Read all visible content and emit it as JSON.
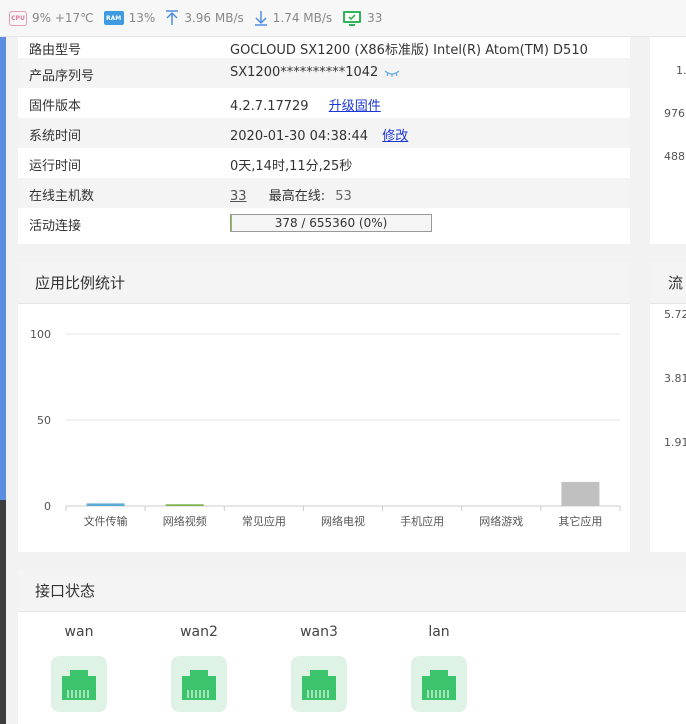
{
  "statusbar": {
    "cpu_icon_label": "CPU",
    "cpu_text": "9% +17℃",
    "ram_icon_label": "RAM",
    "ram_text": "13%",
    "upload_text": "3.96 MB/s",
    "download_text": "1.74 MB/s",
    "hosts_text": "33"
  },
  "info": {
    "rows": [
      {
        "key": "路由型号",
        "value": "GOCLOUD SX1200 (X86标准版) Intel(R) Atom(TM) D510"
      },
      {
        "key": "产品序列号",
        "value": "SX1200**********1042"
      },
      {
        "key": "固件版本",
        "value": "4.2.7.17729",
        "link": "升级固件"
      },
      {
        "key": "系统时间",
        "value": "2020-01-30 04:38:44",
        "link": "修改"
      },
      {
        "key": "运行时间",
        "value": "0天,14时,11分,25秒"
      },
      {
        "key": "在线主机数",
        "value": "33",
        "label2": "最高在线:",
        "value2": "53"
      },
      {
        "key": "活动连接",
        "value": "378 / 655360 (0%)",
        "fraction": 0.0006
      }
    ]
  },
  "app_chart": {
    "title": "应用比例统计"
  },
  "chart_data": {
    "type": "bar",
    "categories": [
      "文件传输",
      "网络视频",
      "常见应用",
      "网络电视",
      "手机应用",
      "网络游戏",
      "其它应用"
    ],
    "values": [
      1.5,
      1.0,
      0,
      0,
      0,
      0,
      14
    ],
    "colors": [
      "#5aa9d6",
      "#7fb34d",
      "#cccccc",
      "#cccccc",
      "#cccccc",
      "#cccccc",
      "#c0c0c0"
    ],
    "yticks": [
      0,
      50,
      100
    ],
    "ylim": [
      0,
      100
    ],
    "grid": true
  },
  "interfaces": {
    "title": "接口状态",
    "items": [
      {
        "name": "wan"
      },
      {
        "name": "wan2"
      },
      {
        "name": "wan3"
      },
      {
        "name": "lan"
      }
    ],
    "port_color": "#3cc46c"
  },
  "right_partial": {
    "top_numbers": [
      "1.",
      "976",
      "488"
    ],
    "chart_title": "流",
    "chart_numbers": [
      "5.72",
      "3.81",
      "1.91"
    ]
  }
}
